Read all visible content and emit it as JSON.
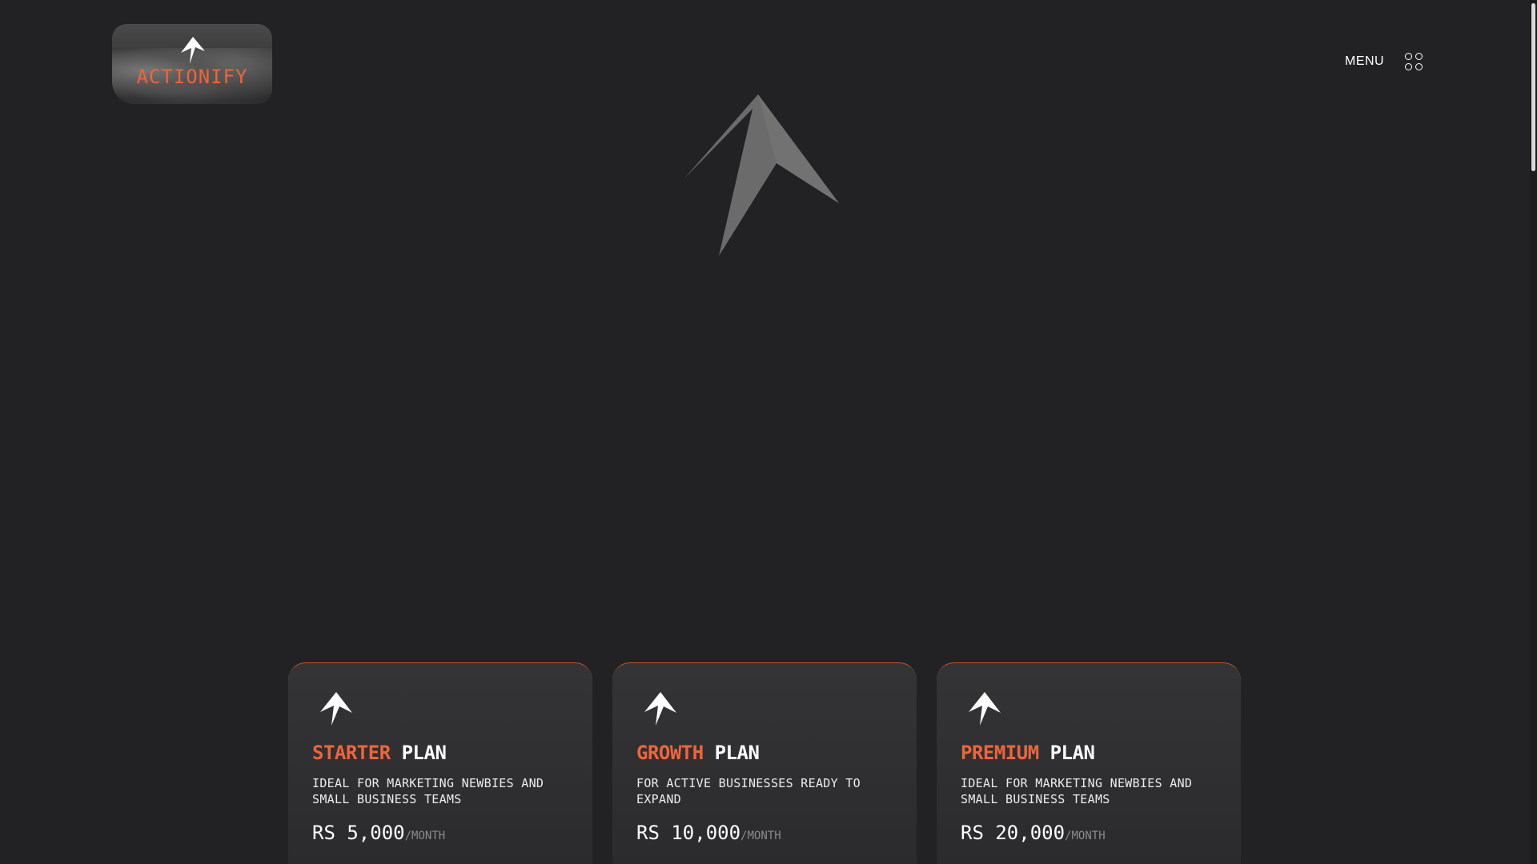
{
  "header": {
    "logo_text": "ACTIONIFY",
    "menu_label": "MENU"
  },
  "colors": {
    "background": "#222224",
    "accent": "#f0643a",
    "card": "#303032",
    "hero_arrow": "#6b6b6b"
  },
  "icons": {
    "logo": "arrow-logo-icon",
    "menu": "grid-dots-icon",
    "hero": "arrow-logo-icon"
  },
  "plans": [
    {
      "name_accent": "STARTER",
      "name_rest": " PLAN",
      "description": "IDEAL FOR MARKETING NEWBIES AND SMALL BUSINESS TEAMS",
      "price": "RS 5,000",
      "period": "/MONTH"
    },
    {
      "name_accent": "GROWTH",
      "name_rest": " PLAN",
      "description": "FOR ACTIVE BUSINESSES READY TO EXPAND",
      "price": "RS 10,000",
      "period": "/MONTH"
    },
    {
      "name_accent": "PREMIUM",
      "name_rest": " PLAN",
      "description": "IDEAL FOR MARKETING NEWBIES AND SMALL BUSINESS TEAMS",
      "price": "RS 20,000",
      "period": "/MONTH"
    }
  ]
}
